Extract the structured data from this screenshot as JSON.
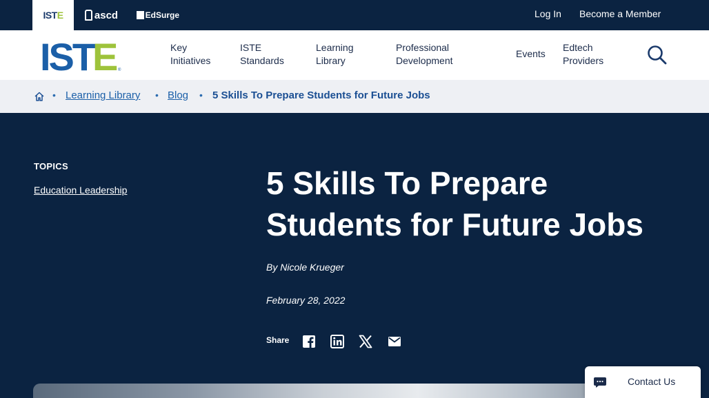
{
  "brands": [
    {
      "name": "ISTE"
    },
    {
      "name": "ascd"
    },
    {
      "name": "EdSurge"
    }
  ],
  "utility_nav": {
    "login": "Log In",
    "member": "Become a Member"
  },
  "logo": {
    "text": "ISTE"
  },
  "main_nav": [
    {
      "label": "Key Initiatives"
    },
    {
      "label": "ISTE Standards"
    },
    {
      "label": "Learning Library"
    },
    {
      "label": "Professional Development"
    },
    {
      "label": "Events"
    },
    {
      "label": "Edtech Providers"
    }
  ],
  "breadcrumb": {
    "home_icon": "home-icon",
    "items": [
      "Learning Library",
      "Blog"
    ],
    "current": "5 Skills To Prepare Students for Future Jobs"
  },
  "topics": {
    "label": "TOPICS",
    "items": [
      "Education Leadership"
    ]
  },
  "article": {
    "title": "5 Skills To Prepare Students for Future Jobs",
    "byline": "By Nicole Krueger",
    "date": "February 28, 2022",
    "share_label": "Share",
    "share_icons": [
      "facebook-icon",
      "linkedin-icon",
      "x-icon",
      "mail-icon"
    ]
  },
  "contact": {
    "label": "Contact Us",
    "icon": "chat-bubble-icon"
  },
  "colors": {
    "navy": "#0b2341",
    "link_blue": "#1b5fa8",
    "iste_green": "#9ec33b",
    "iste_blue": "#1b3a6b"
  }
}
